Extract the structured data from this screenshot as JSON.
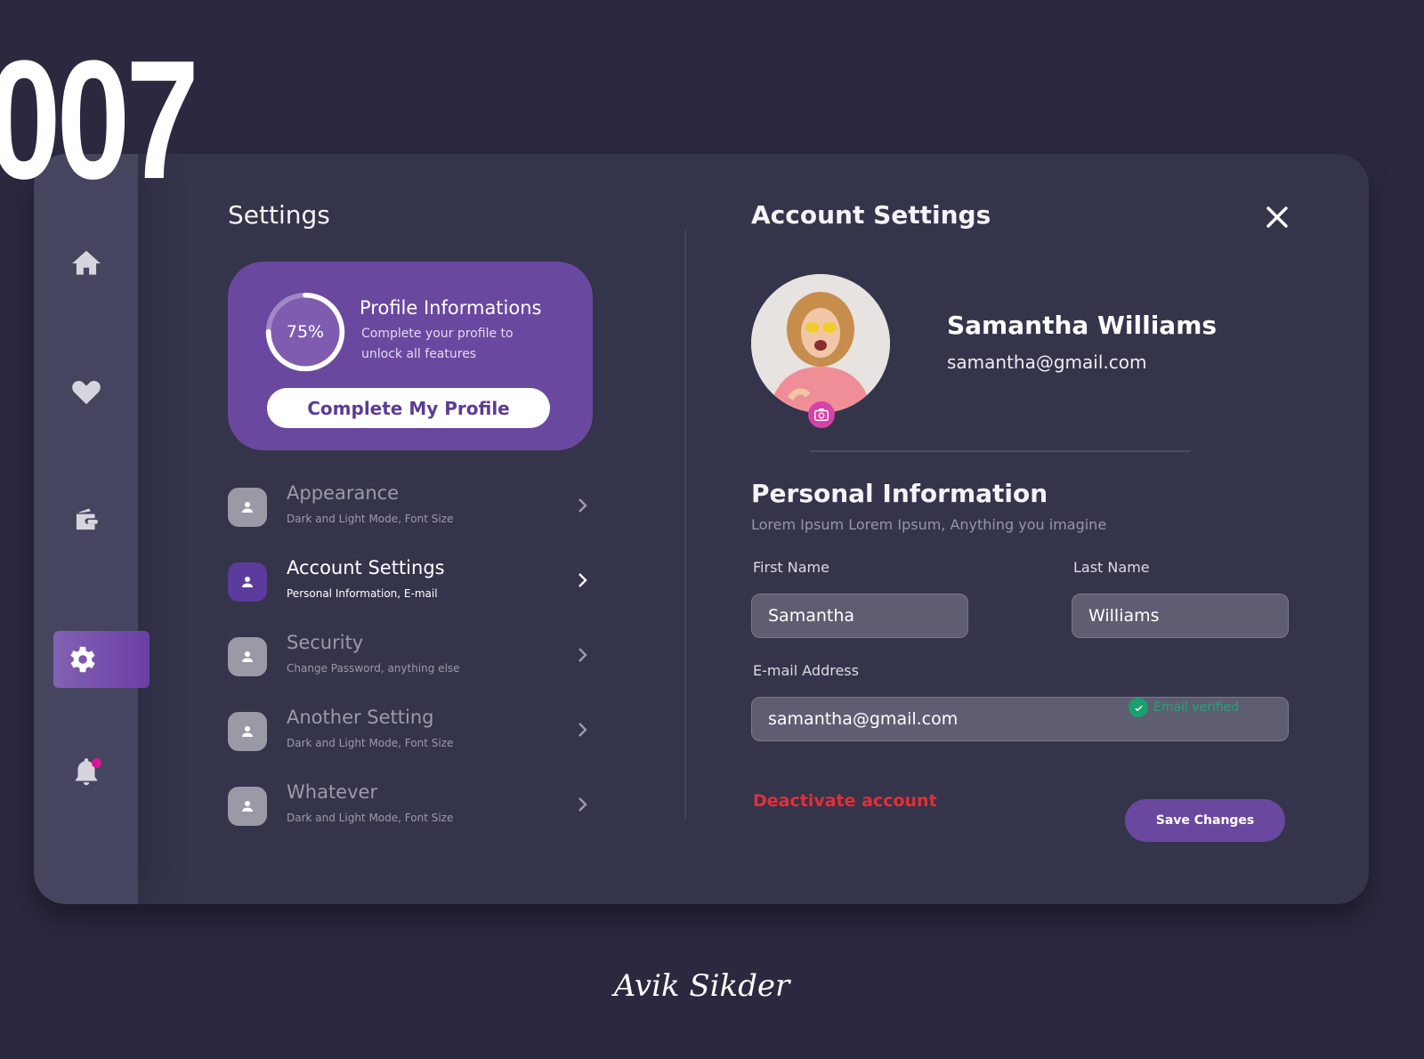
{
  "shot_number": "007",
  "sidebar": {
    "items": [
      {
        "name": "home",
        "icon": "home-icon",
        "active": false
      },
      {
        "name": "favorites",
        "icon": "heart-icon",
        "active": false
      },
      {
        "name": "wallet",
        "icon": "wallet-icon",
        "active": false
      },
      {
        "name": "settings",
        "icon": "gear-icon",
        "active": true
      },
      {
        "name": "notifications",
        "icon": "bell-icon",
        "active": false,
        "has_badge": true
      }
    ]
  },
  "settings_panel": {
    "title": "Settings",
    "profile_card": {
      "progress_percent": 75,
      "progress_label": "75%",
      "title": "Profile Informations",
      "subtitle": "Complete your profile to unlock all features",
      "button_label": "Complete My Profile"
    },
    "menu": [
      {
        "title": "Appearance",
        "subtitle": "Dark and Light Mode, Font Size",
        "icon": "user-icon",
        "active": false
      },
      {
        "title": "Account Settings",
        "subtitle": "Personal Information, E-mail",
        "icon": "user-icon",
        "active": true
      },
      {
        "title": "Security",
        "subtitle": "Change Password, anything else",
        "icon": "user-icon",
        "active": false
      },
      {
        "title": "Another Setting",
        "subtitle": "Dark and Light Mode, Font Size",
        "icon": "user-icon",
        "active": false
      },
      {
        "title": "Whatever",
        "subtitle": "Dark and Light Mode, Font Size",
        "icon": "user-icon",
        "active": false
      }
    ]
  },
  "account_panel": {
    "title": "Account Settings",
    "close_icon": "close-icon",
    "user": {
      "name": "Samantha Williams",
      "email": "samantha@gmail.com"
    },
    "personal_info": {
      "title": "Personal Information",
      "subtitle": "Lorem Ipsum Lorem Ipsum, Anything you imagine",
      "first_name_label": "First Name",
      "first_name_value": "Samantha",
      "last_name_label": "Last Name",
      "last_name_value": "Williams",
      "email_label": "E-mail Address",
      "email_value": "samantha@gmail.com",
      "email_status": "Email verified"
    },
    "deactivate_label": "Deactivate account",
    "save_label": "Save Changes"
  },
  "colors": {
    "background": "#2a2940",
    "card": "#34344b",
    "sidebar": "#45455f",
    "accent": "#6a489f",
    "danger": "#e03038",
    "success": "#1fa774",
    "notification": "#d8159a"
  },
  "signature": "Avik Sikder"
}
